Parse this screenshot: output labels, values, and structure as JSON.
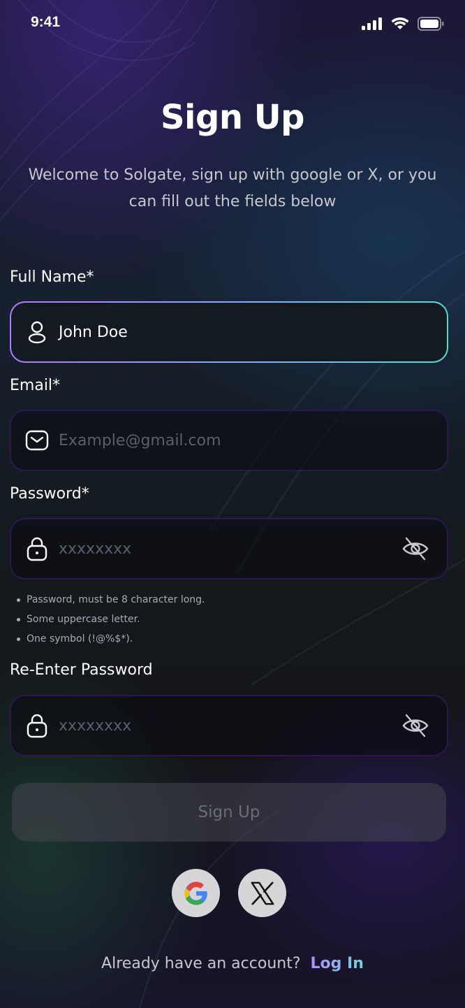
{
  "status_bar": {
    "time": "9:41",
    "icons": [
      "cellular-signal-icon",
      "wifi-icon",
      "battery-icon"
    ]
  },
  "header": {
    "title": "Sign Up",
    "subtitle": "Welcome to Solgate, sign up with google or X, or you can fill out the fields below"
  },
  "form": {
    "full_name": {
      "label": "Full Name*",
      "value": "John Doe",
      "icon": "user-icon"
    },
    "email": {
      "label": "Email*",
      "value": "",
      "placeholder": "Example@gmail.com",
      "icon": "mail-icon"
    },
    "password": {
      "label": "Password*",
      "value": "",
      "placeholder": "xxxxxxxx",
      "icon": "lock-icon",
      "toggle_icon": "eye-off-icon"
    },
    "password_hints": [
      "Password, must be 8 character long.",
      "Some uppercase letter.",
      "One symbol (!@%$*)."
    ],
    "confirm_password": {
      "label": "Re-Enter Password",
      "value": "",
      "placeholder": "xxxxxxxx",
      "icon": "lock-icon",
      "toggle_icon": "eye-off-icon"
    },
    "submit_label": "Sign Up"
  },
  "social": {
    "buttons": [
      "google-icon",
      "x-logo-icon"
    ]
  },
  "footer": {
    "prompt": "Already have an account?",
    "login_label": "Log In"
  },
  "colors": {
    "accent_gradient_start": "#b58cff",
    "accent_gradient_end": "#6ad7d6",
    "field_border": "#2b1850",
    "button_disabled_bg": "#3c3c44",
    "button_disabled_text": "#6b6d74"
  }
}
